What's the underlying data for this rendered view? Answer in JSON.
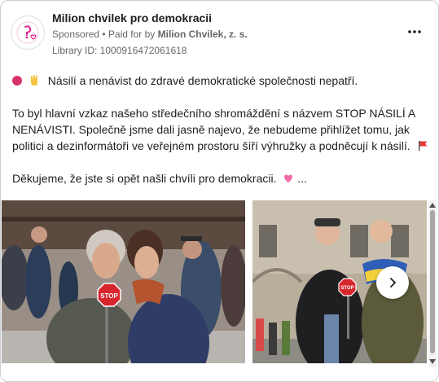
{
  "header": {
    "page_name": "Milion chvilek pro demokracii",
    "sponsored": "Sponsored",
    "paid_prefix": "• Paid for by",
    "paid_by": "Milion Chvilek, z. s.",
    "library_id": "Library ID: 1000916472061618"
  },
  "post": {
    "line1": "Násilí a nenávist do zdravé demokratické společnosti nepatří.",
    "paragraph2_line1": "To byl hlavní vzkaz našeho středečního shromáždění s názvem STOP NÁSILÍ A",
    "paragraph2_line2": "NENÁVISTI. Společně jsme dali jasně najevo, že nebudeme přihlížet tomu, jak",
    "paragraph2_line3": "politici a dezinformátoři ve veřejném prostoru šíří výhružky a podněcují k násilí.",
    "paragraph3": "Děkujeme, že jste si opět našli chvíli pro demokracii.",
    "ellipsis": "..."
  },
  "carousel": {
    "sign_text": "STOP",
    "sign_text_2": "STOP"
  },
  "icons": {
    "avatar": "logo-icon",
    "more": "more-dots-icon",
    "next": "chevron-right-icon"
  },
  "colors": {
    "accent_pink": "#e0298f",
    "stop_red": "#d7262e"
  }
}
